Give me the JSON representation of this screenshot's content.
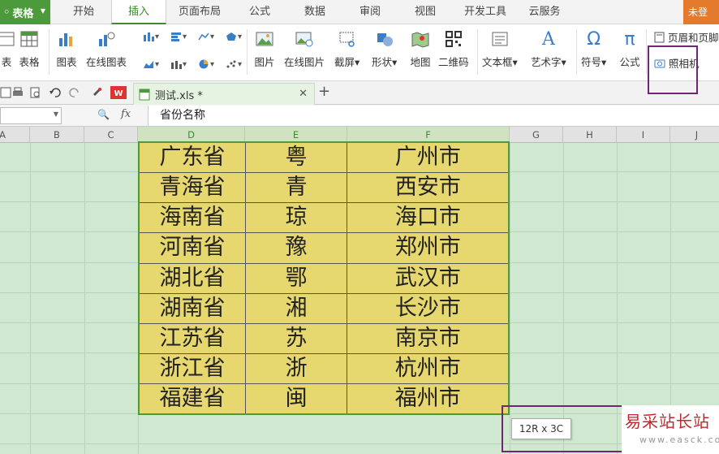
{
  "app": {
    "name": "表格"
  },
  "menu": {
    "tabs": [
      "开始",
      "插入",
      "页面布局",
      "公式",
      "数据",
      "审阅",
      "视图",
      "开发工具",
      "云服务"
    ],
    "active": "插入",
    "login": "未登"
  },
  "ribbon": {
    "chart_table_left": "表",
    "table": "表格",
    "chart": "图表",
    "online_chart": "在线图表",
    "picture": "图片",
    "online_picture": "在线图片",
    "screenshot": "截屏",
    "shape": "形状",
    "map": "地图",
    "qrcode": "二维码",
    "textbox": "文本框",
    "wordart": "艺术字",
    "symbol": "符号",
    "formula": "公式",
    "header_footer": "页眉和页脚",
    "camera": "照相机"
  },
  "document": {
    "tab_title": "测试.xls *"
  },
  "formula_bar": {
    "fx": "fx",
    "content": "省份名称"
  },
  "columns": [
    "A",
    "B",
    "C",
    "D",
    "E",
    "F",
    "G",
    "H",
    "I",
    "J"
  ],
  "table": {
    "rows": [
      [
        "广东省",
        "粤",
        "广州市"
      ],
      [
        "青海省",
        "青",
        "西安市"
      ],
      [
        "海南省",
        "琼",
        "海口市"
      ],
      [
        "河南省",
        "豫",
        "郑州市"
      ],
      [
        "湖北省",
        "鄂",
        "武汉市"
      ],
      [
        "湖南省",
        "湘",
        "长沙市"
      ],
      [
        "江苏省",
        "苏",
        "南京市"
      ],
      [
        "浙江省",
        "浙",
        "杭州市"
      ],
      [
        "福建省",
        "闽",
        "福州市"
      ]
    ]
  },
  "tooltip": "12R x 3C",
  "watermark": {
    "line1": "易采站长站",
    "line2": "www.easck.com"
  },
  "colors": {
    "accent": "#4c9a3c",
    "highlight": "#6b2a6f",
    "cell_fill": "#e6d76e",
    "grid_bg": "#cfe8cf"
  }
}
